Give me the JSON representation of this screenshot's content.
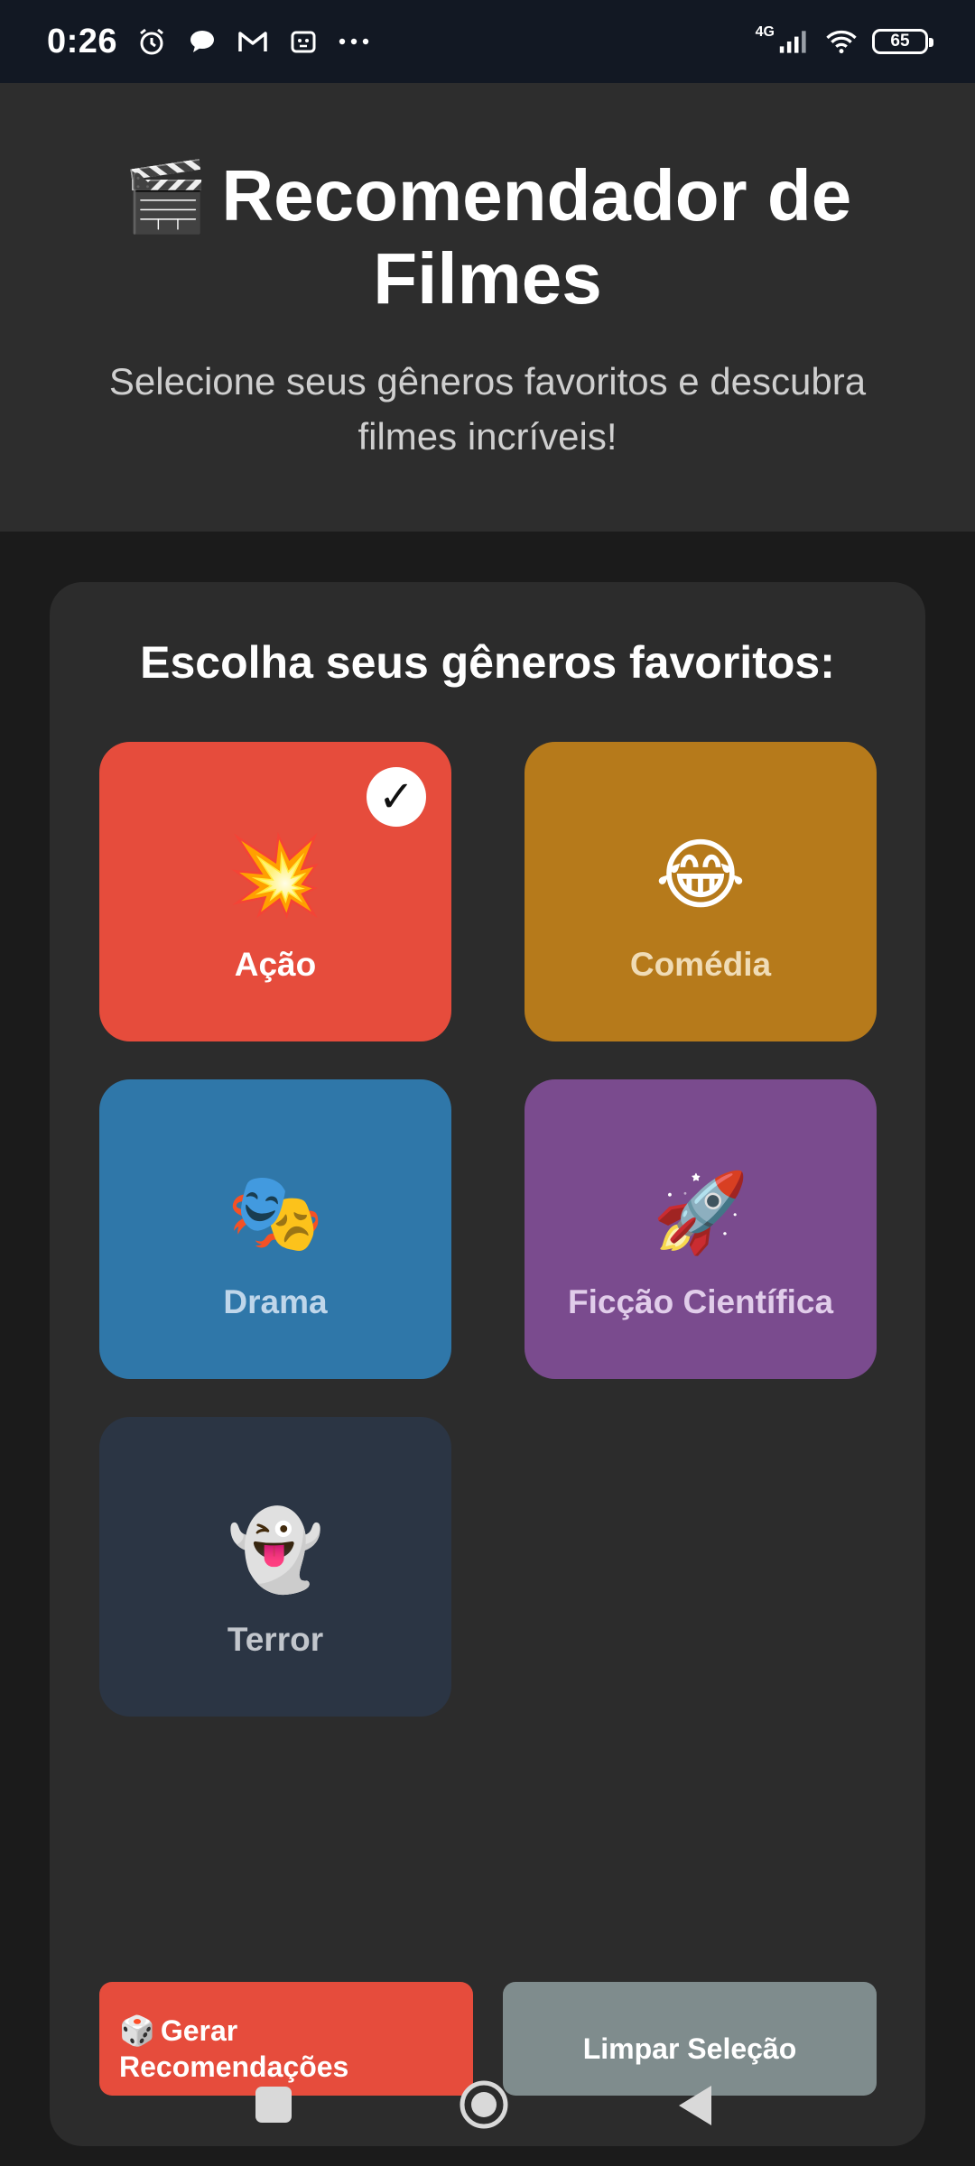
{
  "status_bar": {
    "time": "0:26",
    "icons": [
      "alarm-icon",
      "chat-bubble-icon",
      "gmail-icon",
      "robot-icon",
      "more-dots-icon"
    ],
    "network": "4G",
    "battery": "65"
  },
  "header": {
    "title_emoji": "🎬",
    "title": "Recomendador de Filmes",
    "subtitle": "Selecione seus gêneros favoritos e descubra filmes incríveis!"
  },
  "genres_section": {
    "title": "Escolha seus gêneros favoritos:",
    "selected_mark": "✓",
    "items": [
      {
        "emoji": "💥",
        "label": "Ação",
        "color": "#e64c3c",
        "selected": true
      },
      {
        "emoji": "😂",
        "label": "Comédia",
        "color": "#b67a1b",
        "selected": false
      },
      {
        "emoji": "🎭",
        "label": "Drama",
        "color": "#2f77a9",
        "selected": false
      },
      {
        "emoji": "🚀",
        "label": "Ficção Científica",
        "color": "#7a4b8e",
        "selected": false
      },
      {
        "emoji": "👻",
        "label": "Terror",
        "color": "#2b3544",
        "selected": false
      }
    ]
  },
  "actions": {
    "generate_icon": "🎲",
    "generate_label": "Gerar Recomendações",
    "clear_label": "Limpar Seleção"
  },
  "colors": {
    "background": "#1b1b1b",
    "header_bg": "#2d2d2d",
    "card_bg": "#2c2c2c",
    "accent_red": "#e64c3c",
    "clear_button": "#7f8c8d"
  }
}
